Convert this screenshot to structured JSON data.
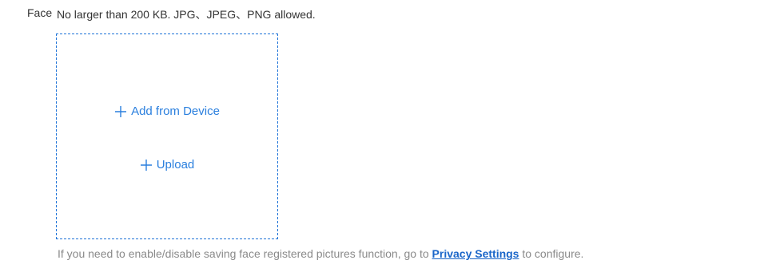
{
  "face_field": {
    "label": "Face",
    "hint": "No larger than 200 KB. JPG、JPEG、PNG allowed."
  },
  "upload_box": {
    "add_from_device_label": "Add from Device",
    "upload_label": "Upload",
    "icon": "plus-icon",
    "accent_color": "#2a7fde"
  },
  "footer": {
    "prefix": "If you need to enable/disable saving face registered pictures function, go to ",
    "link_text": "Privacy Settings",
    "suffix": " to configure."
  }
}
